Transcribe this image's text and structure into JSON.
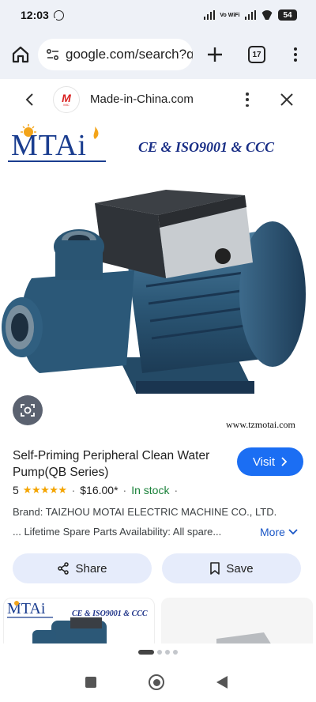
{
  "status_bar": {
    "time": "12:03",
    "network": "Vo WiFi",
    "battery": "54"
  },
  "browser": {
    "url": "google.com/search?q",
    "tab_count": "17"
  },
  "panel": {
    "site_name": "Made-in-China.com"
  },
  "product_image": {
    "brand_logo": "MTAi",
    "certifications": "CE & ISO9001 & CCC",
    "website": "www.tzmotai.com"
  },
  "product": {
    "title": "Self-Priming Peripheral Clean Water Pump(QB Series)",
    "rating": "5",
    "stars": 5,
    "price": "$16.00*",
    "stock": "In stock",
    "brand_line": "Brand: TAIZHOU MOTAI ELECTRIC MACHINE CO., LTD.",
    "snippet": "... Lifetime Spare Parts Availability: All spare...",
    "more_label": "More",
    "visit_label": "Visit"
  },
  "actions": {
    "share_label": "Share",
    "save_label": "Save"
  },
  "related": {
    "card1_logo": "MTAi",
    "card1_cert": "CE & ISO9001 & CCC"
  },
  "colors": {
    "accent_blue": "#1b6ef3",
    "in_stock_green": "#188038",
    "star_gold": "#f4a400",
    "chip_bg": "#e6ecfb"
  }
}
